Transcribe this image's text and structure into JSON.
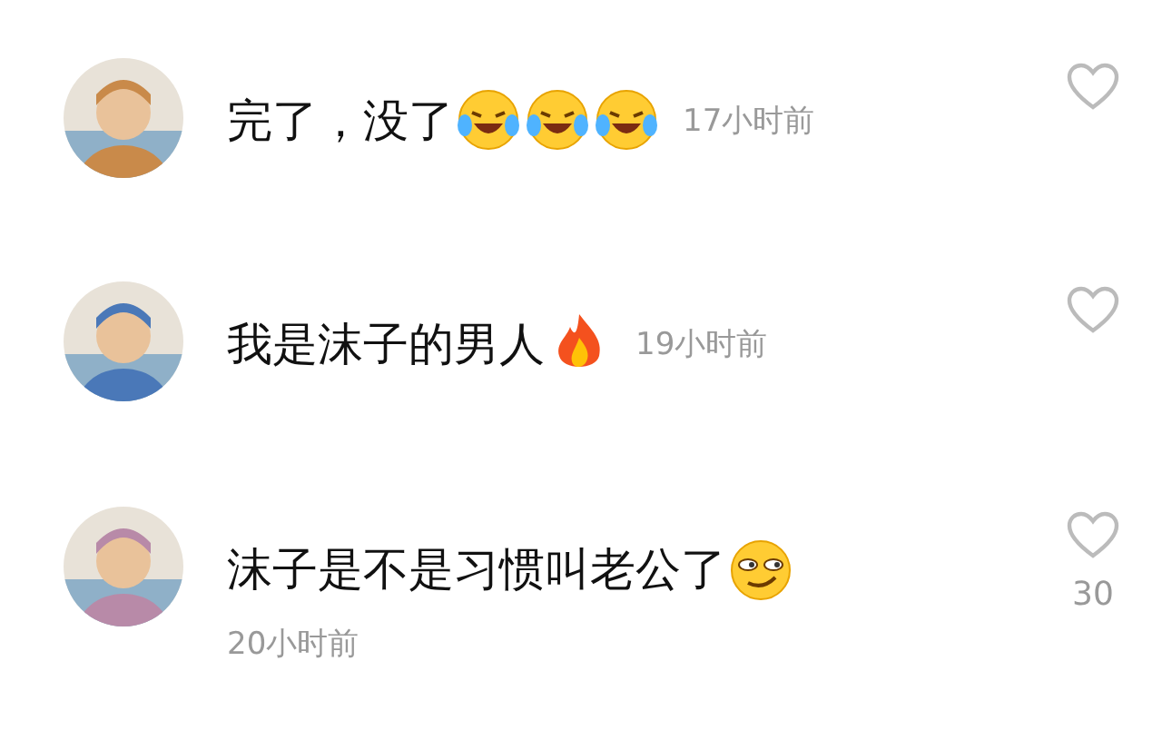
{
  "comments": [
    {
      "text": "完了，没了",
      "emojis": [
        {
          "kind": "laugh-cry"
        },
        {
          "kind": "laugh-cry"
        },
        {
          "kind": "laugh-cry"
        }
      ],
      "time": "17小时前",
      "time_below": false
    },
    {
      "text": "我是沫子的男人",
      "emojis": [
        {
          "kind": "fire"
        }
      ],
      "time": "19小时前",
      "time_below": false
    },
    {
      "text": "沫子是不是习惯叫老公了",
      "emojis": [
        {
          "kind": "smirk"
        }
      ],
      "time": "20小时前",
      "time_below": true,
      "likes": "30"
    }
  ]
}
